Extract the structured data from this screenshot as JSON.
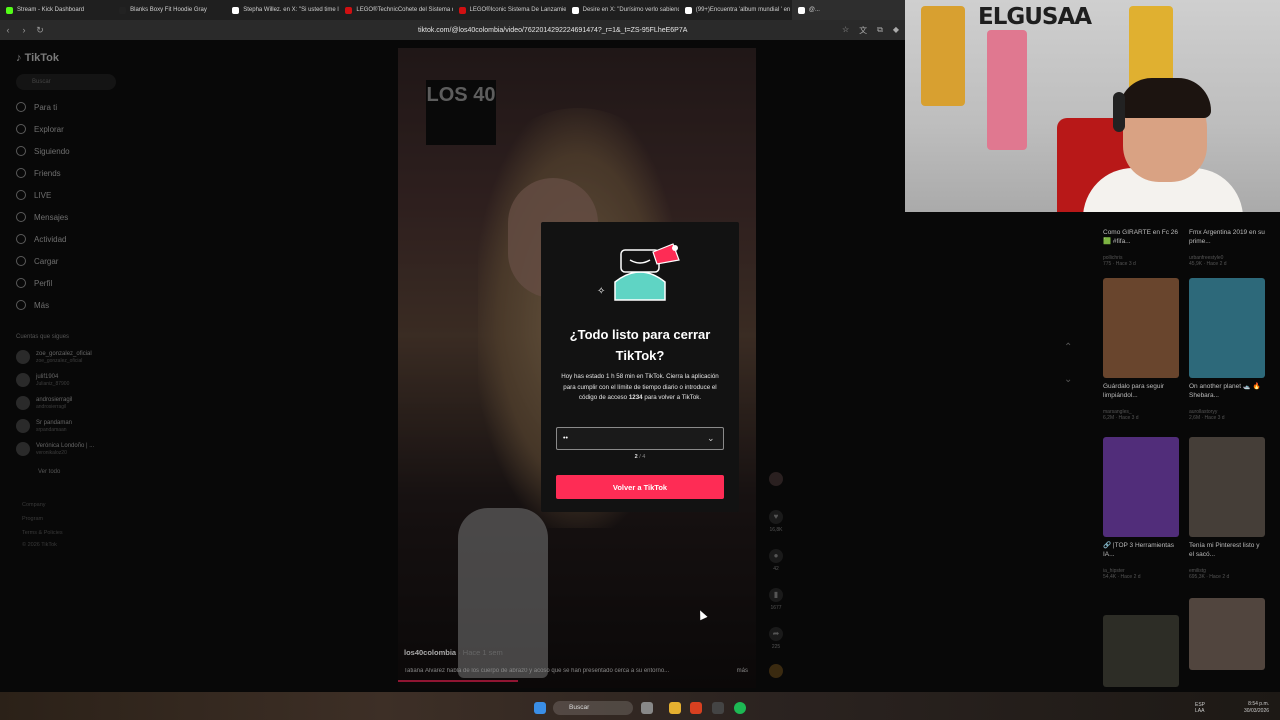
{
  "browser": {
    "tabs": [
      {
        "label": "Stream - Kick Dashboard",
        "color": "#53fc18"
      },
      {
        "label": "Blanks Boxy Fit Hoodie Gray",
        "color": "#222222"
      },
      {
        "label": "Stepha Willez. en X: \"Si usted time la",
        "color": "#ffffff"
      },
      {
        "label": "LEGO®TechnicCohete del Sistema d",
        "color": "#d01012"
      },
      {
        "label": "LEGO®Iconic Sistema De Lanzamien",
        "color": "#d01012"
      },
      {
        "label": "Desire en X: \"Durísimo verlo sabiend",
        "color": "#ffffff"
      },
      {
        "label": "(99+)Encuentra 'album mundial ' en",
        "color": "#ffffff"
      },
      {
        "label": "@...",
        "color": "#ffffff"
      }
    ],
    "url": "tiktok.com/@los40colombia/video/7622014292224691474?_r=1&_t=ZS-95FLheE6P7A"
  },
  "sidebar": {
    "logo": "TikTok",
    "search_placeholder": "Buscar",
    "items": [
      {
        "label": "Para ti",
        "icon": "home-icon"
      },
      {
        "label": "Explorar",
        "icon": "compass-icon"
      },
      {
        "label": "Siguiendo",
        "icon": "following-icon"
      },
      {
        "label": "Friends",
        "icon": "friends-icon"
      },
      {
        "label": "LIVE",
        "icon": "live-icon"
      },
      {
        "label": "Mensajes",
        "icon": "messages-icon"
      },
      {
        "label": "Actividad",
        "icon": "activity-icon"
      },
      {
        "label": "Cargar",
        "icon": "upload-icon"
      },
      {
        "label": "Perfil",
        "icon": "profile-icon"
      },
      {
        "label": "Más",
        "icon": "more-icon"
      }
    ],
    "following_title": "Cuentas que sigues",
    "accounts": [
      {
        "name": "zoe_gonzalez_oficial",
        "handle": "zoe_gonzalez_oficial"
      },
      {
        "name": "julif1904",
        "handle": "Julianiz_87900"
      },
      {
        "name": "androsierragil",
        "handle": "androsierragil"
      },
      {
        "name": "Sr pandaman",
        "handle": "srpandamaan"
      },
      {
        "name": "Verónica Londoño | ...",
        "handle": "veronikaloz20"
      }
    ],
    "see_all": "Ver todo",
    "footer": [
      "Company",
      "Program",
      "Terms & Policies",
      "© 2026 TikTok"
    ]
  },
  "video": {
    "brand": "LOS 40",
    "user": "los40colombia",
    "time_ago": "· Hace 1 sem",
    "description": "Tatiana Álvarez habla de los cuerpo de abraz0 y acoso que se han presentado cerca a su entorno...",
    "more": "más",
    "actions": [
      {
        "icon": "heart-icon",
        "count": "16,8K"
      },
      {
        "icon": "comment-icon",
        "count": "42"
      },
      {
        "icon": "bookmark-icon",
        "count": "1677"
      },
      {
        "icon": "share-icon",
        "count": "225"
      }
    ]
  },
  "modal": {
    "title": "¿Todo listo para cerrar TikTok?",
    "body_pre": "Hoy has estado 1 h 58 min en TikTok. Cierra la aplicación para cumplir con el límite de tiempo diario o introduce el código de acceso",
    "code": "1234",
    "body_post": "para volver a TikTok.",
    "input_value": "••",
    "count_current": "2",
    "count_total": "/ 4",
    "button": "Volver a TikTok"
  },
  "recommended": [
    {
      "title": "Como GIRARTE en Fc 26 🟩 #fifa...",
      "user": "pollichris",
      "meta": "775 · Hace 3 d",
      "color": "#2a4a3a"
    },
    {
      "title": "Fmx Argentina 2019 en su prime...",
      "user": "urbanfreestyle0",
      "meta": "45,9K · Hace 2 d",
      "color": "#2a2a3a"
    },
    {
      "title": "Guárdalo para seguir limpiándol...",
      "user": "marsangles_",
      "meta": "6,2M · Hace 3 d",
      "color": "#8a5a3a"
    },
    {
      "title": "On another planet 🛥️ 🔥 Shebara...",
      "user": "aurollastoryy",
      "meta": "2,6M · Hace 3 d",
      "color": "#3a8aa0"
    },
    {
      "title": "🔗 |TOP 3 Herramientas IA...",
      "user": "ia_hipster",
      "meta": "54,4K · Hace 2 d",
      "color": "#6a3aa0"
    },
    {
      "title": "Tenía mi Pinterest listo y el sacó...",
      "user": "emilistg",
      "meta": "695,3K · Hace 2 d",
      "color": "#5a5048"
    },
    {
      "title": "",
      "user": "",
      "meta": "",
      "color": "#3a3a30"
    },
    {
      "title": "",
      "user": "",
      "meta": "",
      "color": "#6a5a50"
    }
  ],
  "webcam": {
    "overlay_text": "ELGUSAA"
  },
  "taskbar": {
    "search_label": "Buscar",
    "lang": "ESP\nLAA",
    "time": "8:54 p.m.\n30/03/2026"
  }
}
